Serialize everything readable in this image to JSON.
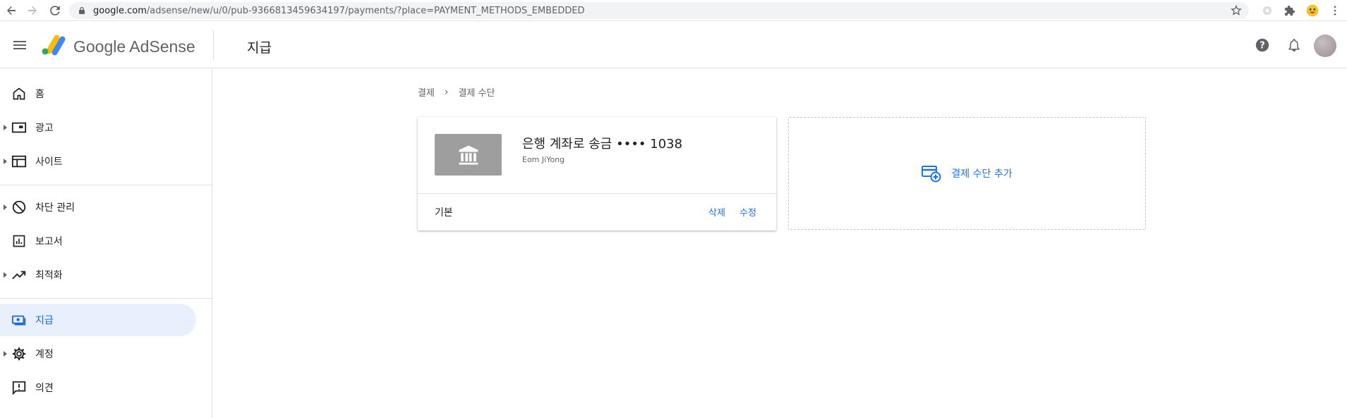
{
  "browser": {
    "url_host": "google.com",
    "url_path": "/adsense/new/u/0/pub-9366813459634197/payments/?place=PAYMENT_METHODS_EMBEDDED"
  },
  "header": {
    "brand": "Google AdSense",
    "page_title": "지급"
  },
  "sidebar": {
    "items": [
      {
        "label": "홈",
        "icon": "home-icon",
        "expandable": false
      },
      {
        "label": "광고",
        "icon": "ads-icon",
        "expandable": true
      },
      {
        "label": "사이트",
        "icon": "sites-icon",
        "expandable": true
      },
      {
        "label": "차단 관리",
        "icon": "block-icon",
        "expandable": true
      },
      {
        "label": "보고서",
        "icon": "reports-icon",
        "expandable": false
      },
      {
        "label": "최적화",
        "icon": "optimization-icon",
        "expandable": true
      },
      {
        "label": "지급",
        "icon": "payments-icon",
        "expandable": false,
        "active": true
      },
      {
        "label": "계정",
        "icon": "settings-icon",
        "expandable": true
      },
      {
        "label": "의견",
        "icon": "feedback-icon",
        "expandable": false
      }
    ]
  },
  "breadcrumb": {
    "parent": "결제",
    "separator": "›",
    "current": "결제 수단"
  },
  "payment_method": {
    "title": "은행 계좌로 송금 •••• 1038",
    "owner": "Eom JiYong",
    "default_label": "기본",
    "delete_label": "삭제",
    "edit_label": "수정"
  },
  "add_method": {
    "label": "결제 수단 추가"
  },
  "colors": {
    "accent": "#1a73e8",
    "active_bg": "#e8f0fe",
    "bank_box": "#9e9e9e"
  }
}
